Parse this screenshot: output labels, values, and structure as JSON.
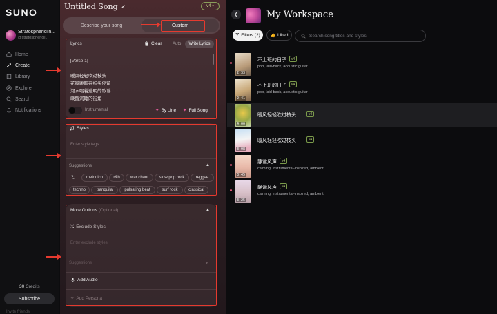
{
  "app": {
    "logo": "SUNO"
  },
  "user": {
    "name": "Stratosphericlin...",
    "handle": "@stratosphericli..."
  },
  "nav": [
    {
      "label": "Home",
      "icon": "home-icon"
    },
    {
      "label": "Create",
      "icon": "create-icon"
    },
    {
      "label": "Library",
      "icon": "library-icon"
    },
    {
      "label": "Explore",
      "icon": "explore-icon"
    },
    {
      "label": "Search",
      "icon": "search-icon"
    },
    {
      "label": "Notifications",
      "icon": "bell-icon"
    }
  ],
  "credits": {
    "count": "30",
    "label": "Credits"
  },
  "subscribe": "Subscribe",
  "sidebar_bottom": "Invite friends",
  "create": {
    "song_title": "Untitled Song",
    "version": "v4",
    "modes": [
      "Describe your song",
      "Custom"
    ],
    "lyrics": {
      "label": "Lyrics",
      "clear": "Clear",
      "auto": "Auto",
      "write": "Write Lyrics",
      "lines": [
        "[Verse 1]",
        "",
        "暖风轻轻吹过枝头",
        "花瓣跳跃在指尖停留",
        "河水唱着透明的歌谣",
        "唤醒沉睡的街角"
      ],
      "instrumental": "Instrumental",
      "by_line": "By Line",
      "full_song": "Full Song"
    },
    "styles": {
      "label": "Styles",
      "placeholder": "Enter style tags",
      "suggestions_label": "Suggestions",
      "chips": [
        "melodico",
        "r&b",
        "war chant",
        "slow pop rock",
        "reggae",
        "techno",
        "tranquila",
        "pulsating beat",
        "surf rock",
        "classical"
      ]
    },
    "more": {
      "label": "More Options",
      "optional": "(Optional)",
      "exclude_label": "Exclude Styles",
      "exclude_placeholder": "Enter exclude styles",
      "suggestions_label": "Suggestions",
      "add_audio": "Add Audio",
      "add_persona": "Add Persona"
    }
  },
  "workspace": {
    "title": "My Workspace",
    "filters": "Filters (2)",
    "liked": "Liked",
    "search_placeholder": "Search song titles and styles",
    "songs": [
      {
        "title": "不上班的日子",
        "version": "v4",
        "tags": "pop, laid-back, acoustic guitar",
        "duration": "2:33",
        "dot": true,
        "selected": false
      },
      {
        "title": "不上班的日子",
        "version": "v4",
        "tags": "pop, laid-back, acoustic guitar",
        "duration": "2:41",
        "dot": false,
        "selected": false
      },
      {
        "title": "暖风轻轻吹过枝头",
        "version": "v4",
        "tags": "",
        "duration": "4:00",
        "dot": false,
        "selected": true
      },
      {
        "title": "暖风轻轻吹过枝头",
        "version": "v4",
        "tags": "",
        "duration": "3:08",
        "dot": false,
        "selected": false
      },
      {
        "title": "静谧风声",
        "version": "v4",
        "tags": "calming, instrumental-inspired, ambient",
        "duration": "3:45",
        "dot": true,
        "selected": false
      },
      {
        "title": "静谧风声",
        "version": "v4",
        "tags": "calming, instrumental-inspired, ambient",
        "duration": "3:25",
        "dot": true,
        "selected": false
      }
    ]
  },
  "colors": {
    "accent": "#e53a2f",
    "badge": "#b8d07a",
    "pink": "#e05a9a"
  }
}
